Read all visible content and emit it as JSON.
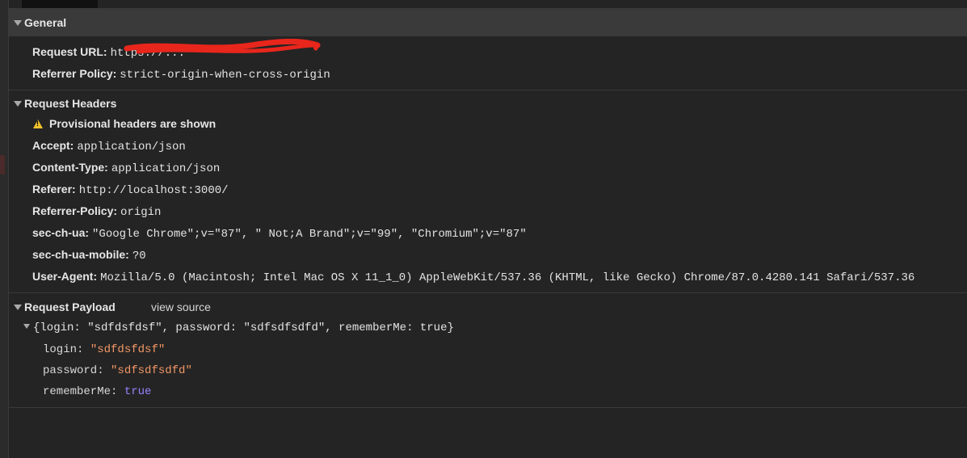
{
  "general": {
    "header": "General",
    "request_url_label": "Request URL:",
    "request_url_value": "https://...",
    "referrer_policy_label": "Referrer Policy:",
    "referrer_policy_value": "strict-origin-when-cross-origin"
  },
  "request_headers": {
    "header": "Request Headers",
    "warning": "Provisional headers are shown",
    "items": [
      {
        "key": "Accept:",
        "value": "application/json"
      },
      {
        "key": "Content-Type:",
        "value": "application/json"
      },
      {
        "key": "Referer:",
        "value": "http://localhost:3000/"
      },
      {
        "key": "Referrer-Policy:",
        "value": "origin"
      },
      {
        "key": "sec-ch-ua:",
        "value": "\"Google Chrome\";v=\"87\", \" Not;A Brand\";v=\"99\", \"Chromium\";v=\"87\""
      },
      {
        "key": "sec-ch-ua-mobile:",
        "value": "?0"
      },
      {
        "key": "User-Agent:",
        "value": "Mozilla/5.0 (Macintosh; Intel Mac OS X 11_1_0) AppleWebKit/537.36 (KHTML, like Gecko) Chrome/87.0.4280.141 Safari/537.36"
      }
    ]
  },
  "request_payload": {
    "header": "Request Payload",
    "view_source": "view source",
    "summary": "{login: \"sdfdsfdsf\", password: \"sdfsdfsdfd\", rememberMe: true}",
    "props": [
      {
        "key": "login:",
        "value": "\"sdfdsfdsf\"",
        "kind": "string"
      },
      {
        "key": "password:",
        "value": "\"sdfsdfsdfd\"",
        "kind": "string"
      },
      {
        "key": "rememberMe:",
        "value": "true",
        "kind": "boolean"
      }
    ]
  },
  "colors": {
    "string": "#f29766",
    "boolean": "#9980ff",
    "warning": "#f2c12e",
    "redaction": "#e8261c"
  }
}
